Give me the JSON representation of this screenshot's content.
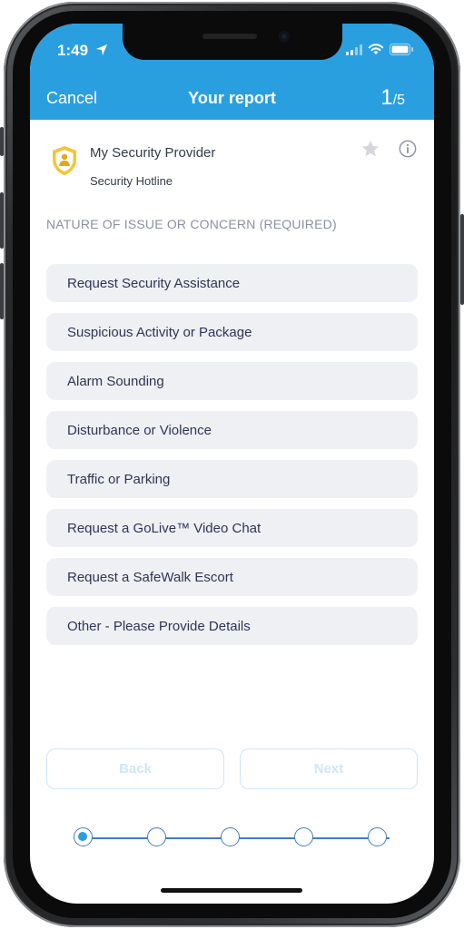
{
  "status_bar": {
    "time": "1:49"
  },
  "header": {
    "cancel_label": "Cancel",
    "title": "Your report",
    "step_current": "1",
    "step_total": "/5",
    "background": "#2a9fdf"
  },
  "provider": {
    "name": "My Security Provider",
    "subtitle": "Security Hotline"
  },
  "section": {
    "heading": "NATURE OF ISSUE OR CONCERN (REQUIRED)"
  },
  "options": [
    "Request Security Assistance",
    "Suspicious Activity or Package",
    "Alarm Sounding",
    "Disturbance or Violence",
    "Traffic or Parking",
    "Request a GoLive™ Video Chat",
    "Request a SafeWalk Escort",
    "Other - Please Provide Details"
  ],
  "footer": {
    "back_label": "Back",
    "next_label": "Next",
    "progress_current_step": 1,
    "progress_total_steps": 5
  },
  "icons": [
    "location-arrow-icon",
    "signal-icon",
    "wifi-icon",
    "battery-icon",
    "shield-logo-icon",
    "star-icon",
    "info-icon"
  ]
}
